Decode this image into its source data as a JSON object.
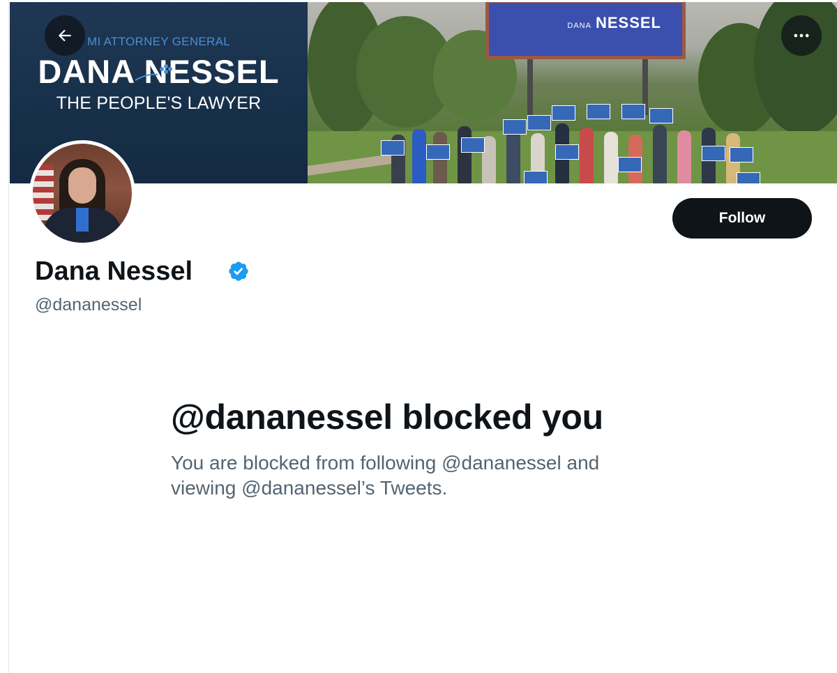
{
  "banner": {
    "subtitle": "MI ATTORNEY GENERAL",
    "name": "DANA NESSEL",
    "tagline": "THE PEOPLE'S LAWYER",
    "billboard_text": "NESSEL",
    "billboard_small": "DANA"
  },
  "nav": {
    "back_icon": "arrow-left-icon",
    "more_icon": "more-horizontal-icon"
  },
  "profile": {
    "display_name": "Dana Nessel",
    "handle": "@dananessel",
    "verified_icon": "verified-badge-icon",
    "follow_label": "Follow"
  },
  "blocked": {
    "title": "@dananessel blocked you",
    "body": "You are blocked from following @dananessel and viewing @dananessel’s Tweets."
  },
  "colors": {
    "text_primary": "#0f1419",
    "text_secondary": "#536471",
    "verified_blue": "#1d9bf0",
    "banner_navy": "#17304a"
  }
}
